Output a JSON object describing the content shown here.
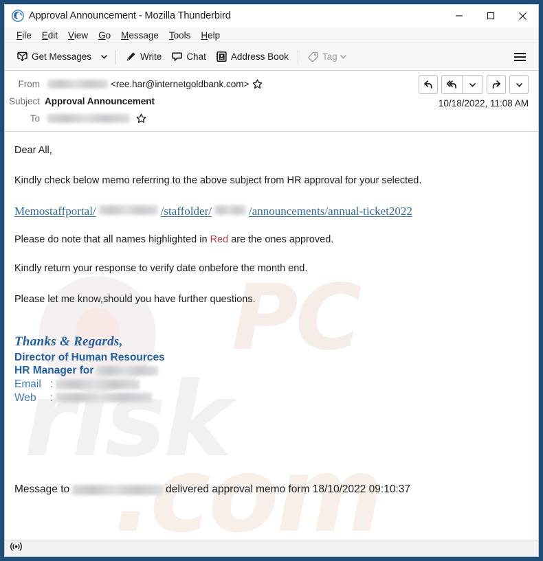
{
  "window": {
    "title": "Approval Announcement - Mozilla Thunderbird",
    "app_icon": "thunderbird-icon",
    "minimize_label": "Minimize",
    "maximize_label": "Maximize",
    "close_label": "Close"
  },
  "menubar": {
    "items": [
      {
        "label": "File",
        "accesskey": "F"
      },
      {
        "label": "Edit",
        "accesskey": "E"
      },
      {
        "label": "View",
        "accesskey": "V"
      },
      {
        "label": "Go",
        "accesskey": "G"
      },
      {
        "label": "Message",
        "accesskey": "M"
      },
      {
        "label": "Tools",
        "accesskey": "T"
      },
      {
        "label": "Help",
        "accesskey": "H"
      }
    ]
  },
  "toolbar": {
    "get_messages": "Get Messages",
    "write": "Write",
    "chat": "Chat",
    "address_book": "Address Book",
    "tag": "Tag",
    "tag_disabled": true,
    "app_menu_label": "Application Menu"
  },
  "message_header": {
    "from_label": "From",
    "from_name_redacted": true,
    "from_address": "<ree.har@internetgoldbank.com>",
    "subject_label": "Subject",
    "subject": "Approval Announcement",
    "to_label": "To",
    "to_redacted": true,
    "date": "10/18/2022, 11:08 AM",
    "actions": {
      "reply": "Reply",
      "reply_all": "Reply All",
      "reply_all_more": "More reply options",
      "forward": "Forward",
      "more": "More"
    }
  },
  "body": {
    "greeting": "Dear All,",
    "intro": "Kindly check below memo referring to the above subject from HR approval for your selected.",
    "link": {
      "part1": "Memostaffportal/",
      "part2": "/staffolder/",
      "part3": "/announcements/annual-ticket2022"
    },
    "note_before": "Please do note that all names highlighted in ",
    "note_highlight": "Red",
    "note_after": " are the ones approved.",
    "response": "Kindly return your response to verify date onbefore the month end.",
    "questions": "Please let me know,should you have further questions.",
    "signature": {
      "thanks": "Thanks & Regards,",
      "title": "Director of Human Resources",
      "role_prefix": "HR Manager for",
      "email_label": "Email",
      "email_sep": ":",
      "web_label": "Web",
      "web_sep": ":"
    },
    "delivery": {
      "prefix": "Message to",
      "suffix": "delivered approval memo form 18/10/2022 09:10:37"
    },
    "watermark_text_1": "PC",
    "watermark_text_2": "risk",
    "watermark_text_3": ".com"
  },
  "statusbar": {
    "icon": "broadcast-icon"
  },
  "colors": {
    "window_frame": "#1f4e79",
    "accent_blue": "#1f5fa8",
    "link_blue": "#2f6ca8",
    "red_highlight": "#c23b4b"
  }
}
